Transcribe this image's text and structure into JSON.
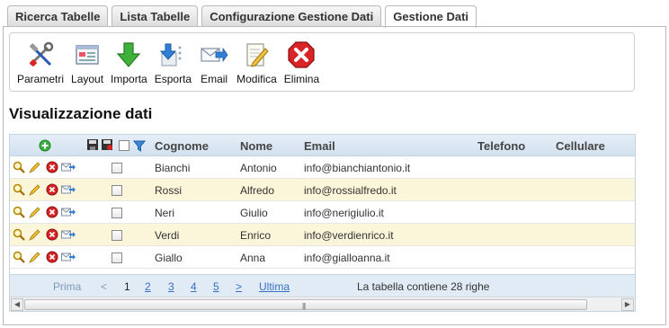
{
  "tabs": [
    {
      "label": "Ricerca Tabelle",
      "active": false
    },
    {
      "label": "Lista Tabelle",
      "active": false
    },
    {
      "label": "Configurazione Gestione Dati",
      "active": false
    },
    {
      "label": "Gestione Dati",
      "active": true
    }
  ],
  "toolbar": {
    "items": [
      {
        "label": "Parametri",
        "icon": "tools-icon"
      },
      {
        "label": "Layout",
        "icon": "layout-icon"
      },
      {
        "label": "Importa",
        "icon": "import-arrow-icon"
      },
      {
        "label": "Esporta",
        "icon": "export-arrow-icon"
      },
      {
        "label": "Email",
        "icon": "email-icon"
      },
      {
        "label": "Modifica",
        "icon": "edit-icon"
      },
      {
        "label": "Elimina",
        "icon": "delete-icon"
      }
    ]
  },
  "section_title": "Visualizzazione dati",
  "grid": {
    "columns": {
      "cognome": "Cognome",
      "nome": "Nome",
      "email": "Email",
      "telefono": "Telefono",
      "cellulare": "Cellulare"
    },
    "rows": [
      {
        "cognome": "Bianchi",
        "nome": "Antonio",
        "email": "info@bianchiantonio.it",
        "telefono": "",
        "cellulare": ""
      },
      {
        "cognome": "Rossi",
        "nome": "Alfredo",
        "email": "info@rossialfredo.it",
        "telefono": "",
        "cellulare": ""
      },
      {
        "cognome": "Neri",
        "nome": "Giulio",
        "email": "info@nerigiulio.it",
        "telefono": "",
        "cellulare": ""
      },
      {
        "cognome": "Verdi",
        "nome": "Enrico",
        "email": "info@verdienrico.it",
        "telefono": "",
        "cellulare": ""
      },
      {
        "cognome": "Giallo",
        "nome": "Anna",
        "email": "info@gialloanna.it",
        "telefono": "",
        "cellulare": ""
      }
    ],
    "pager": {
      "first": "Prima",
      "prev": "<",
      "pages": [
        "1",
        "2",
        "3",
        "4",
        "5"
      ],
      "next": ">",
      "last": "Ultima",
      "summary": "La tabella contiene 28 righe"
    }
  },
  "colors": {
    "header_bg": "#d2e1ef",
    "alt_row_bg": "#fbf5d9",
    "pager_bg": "#e0ebf5",
    "link": "#3a6fc2"
  }
}
